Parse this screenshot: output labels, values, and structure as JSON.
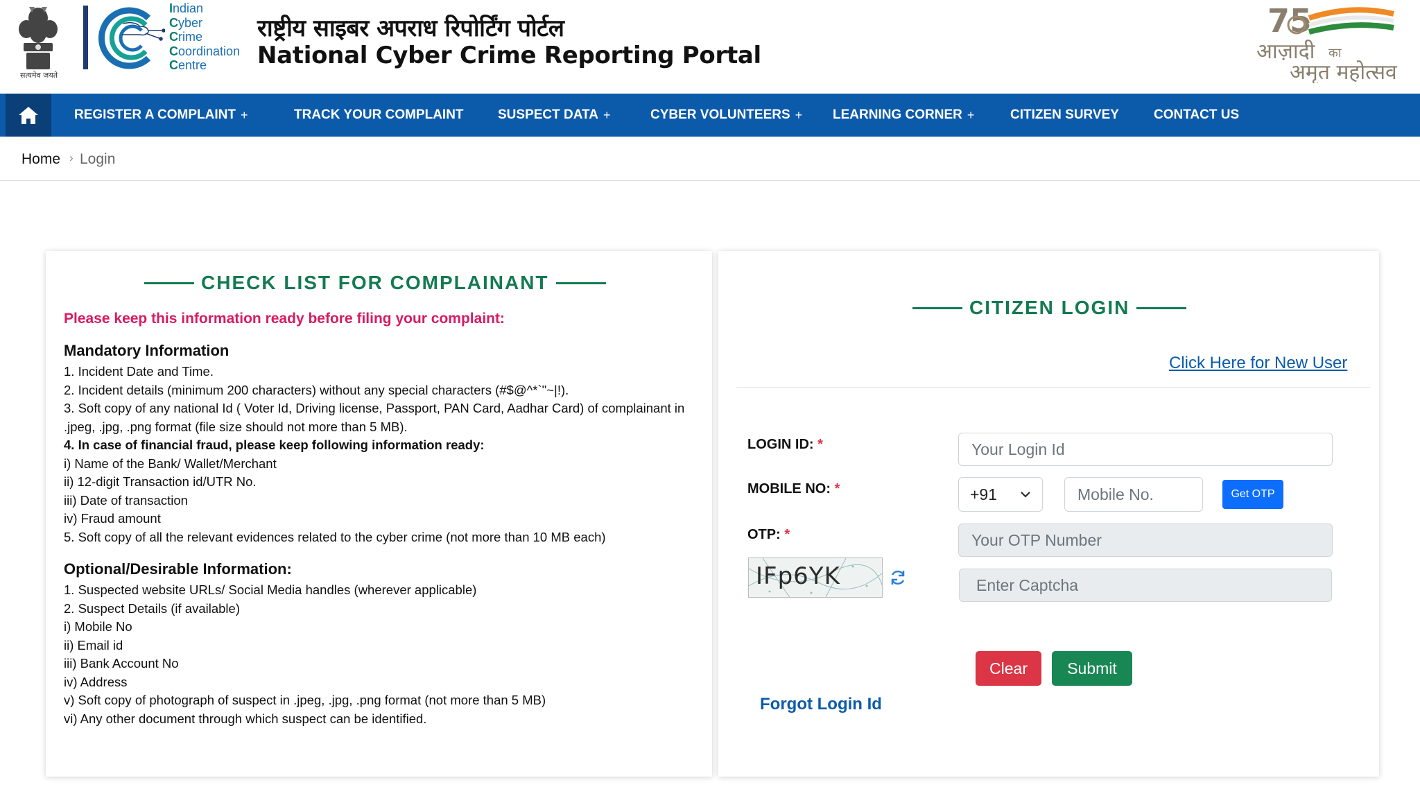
{
  "header": {
    "emblem_caption": "सत्यमेव जयते",
    "org_lines": [
      {
        "first": "I",
        "rest": "ndian"
      },
      {
        "first": "C",
        "rest": "yber"
      },
      {
        "first": "C",
        "rest": "rime"
      },
      {
        "first": "C",
        "rest": "oordination"
      },
      {
        "first": "C",
        "rest": "entre"
      }
    ],
    "title_hindi": "राष्ट्रीय साइबर अपराध रिपोर्टिंग पोर्टल",
    "title_english": "National Cyber Crime Reporting Portal",
    "azadi_text_1": "आज़ादी",
    "azadi_text_ka": "का",
    "azadi_text_2": "अमृत महोत्सव",
    "azadi_number": "75"
  },
  "nav": {
    "items": [
      {
        "label": "REGISTER A COMPLAINT",
        "plus": "+"
      },
      {
        "label": "TRACK YOUR COMPLAINT",
        "plus": ""
      },
      {
        "label": "SUSPECT DATA",
        "plus": "+"
      },
      {
        "label": "CYBER VOLUNTEERS",
        "plus": "+"
      },
      {
        "label": "LEARNING CORNER",
        "plus": "+"
      },
      {
        "label": "CITIZEN SURVEY",
        "plus": ""
      },
      {
        "label": "CONTACT US",
        "plus": ""
      }
    ]
  },
  "breadcrumb": {
    "home": "Home",
    "separator": "›",
    "current": "Login"
  },
  "checklist": {
    "title": "CHECK LIST FOR COMPLAINANT",
    "instruction": "Please keep this information ready before filing your complaint:",
    "mandatory_heading": "Mandatory Information",
    "mandatory_items": [
      "1. Incident Date and Time.",
      "2. Incident details (minimum 200 characters) without any special characters (#$@^*`\"~|!).",
      "3. Soft copy of any national Id ( Voter Id, Driving license, Passport, PAN Card, Aadhar Card) of complainant in .jpeg, .jpg, .png format (file size should not more than 5 MB).",
      "4. In case of financial fraud, please keep following information ready:",
      "i) Name of the Bank/ Wallet/Merchant",
      "ii) 12-digit Transaction id/UTR No.",
      "iii) Date of transaction",
      "iv) Fraud amount",
      "5. Soft copy of all the relevant evidences related to the cyber crime (not more than 10 MB each)"
    ],
    "optional_heading": "Optional/Desirable Information:",
    "optional_items": [
      "1. Suspected website URLs/ Social Media handles (wherever applicable)",
      "2. Suspect Details (if available)",
      "i) Mobile No",
      "ii) Email id",
      "iii) Bank Account No",
      "iv) Address",
      "v) Soft copy of photograph of suspect in .jpeg, .jpg, .png format (not more than 5 MB)",
      "vi) Any other document through which suspect can be identified."
    ]
  },
  "login": {
    "title": "CITIZEN LOGIN",
    "new_user_link": "Click Here for New User",
    "login_id_label": "LOGIN ID:",
    "login_id_placeholder": "Your Login Id",
    "mobile_label": "MOBILE NO:",
    "country_code": "+91",
    "mobile_placeholder": "Mobile No.",
    "get_otp": "Get OTP",
    "otp_label": "OTP:",
    "otp_placeholder": "Your OTP Number",
    "captcha_text": "IFp6YK",
    "captcha_placeholder": "Enter Captcha",
    "required_mark": "*",
    "clear": "Clear",
    "submit": "Submit",
    "forgot": "Forgot Login Id"
  },
  "colors": {
    "nav_blue": "#0c5baa",
    "nav_home": "#0a3f78",
    "section_green": "#137a52",
    "instruction_pink": "#d81b60",
    "clear_red": "#dc3545",
    "submit_green": "#198754",
    "otp_blue": "#0d6efd"
  }
}
